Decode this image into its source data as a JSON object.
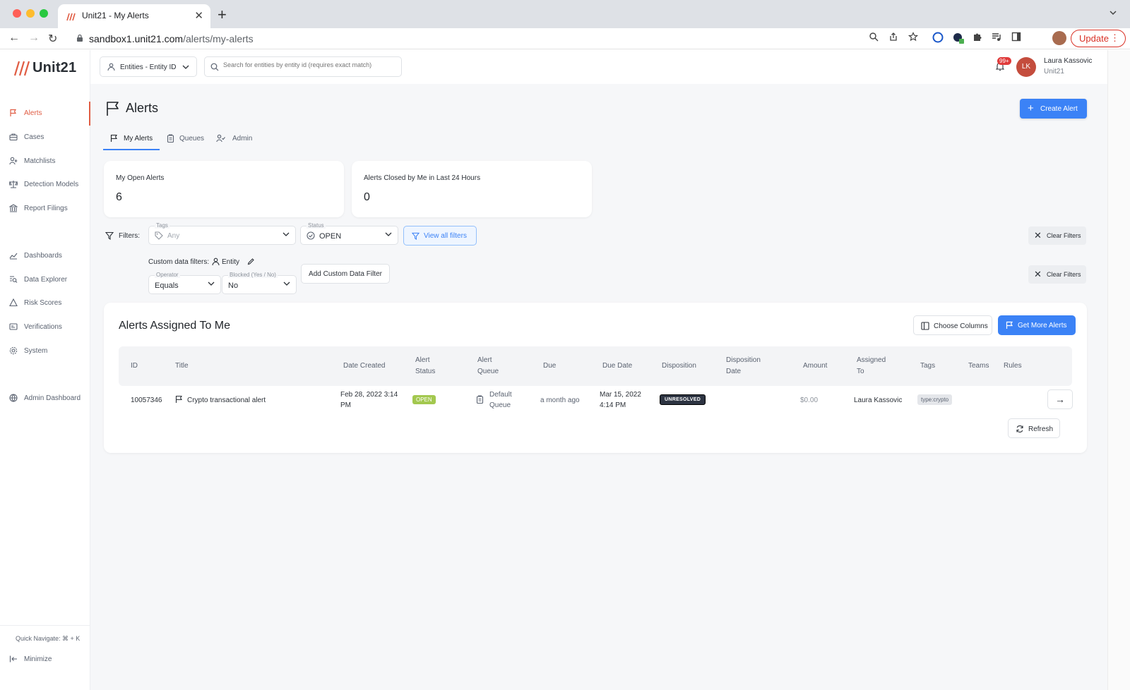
{
  "browser": {
    "tab_title": "Unit21 - My Alerts",
    "url_host": "sandbox1.unit21.com",
    "url_path": "/alerts/my-alerts",
    "update_label": "Update"
  },
  "sidebar": {
    "brand": "Unit21",
    "items": [
      {
        "label": "Alerts",
        "icon": "flag-icon"
      },
      {
        "label": "Cases",
        "icon": "briefcase-icon"
      },
      {
        "label": "Matchlists",
        "icon": "user-plus-icon"
      },
      {
        "label": "Detection Models",
        "icon": "scale-icon"
      },
      {
        "label": "Report Filings",
        "icon": "bank-icon"
      },
      {
        "label": "Dashboards",
        "icon": "chart-icon"
      },
      {
        "label": "Data Explorer",
        "icon": "search-list-icon"
      },
      {
        "label": "Risk Scores",
        "icon": "warning-icon"
      },
      {
        "label": "Verifications",
        "icon": "id-card-icon"
      },
      {
        "label": "System",
        "icon": "gear-icon"
      },
      {
        "label": "Admin Dashboard",
        "icon": "globe-icon"
      }
    ],
    "quick_navigate": "Quick Navigate: ⌘ + K",
    "minimize": "Minimize"
  },
  "topbar": {
    "entity_select": "Entities - Entity ID",
    "search_placeholder": "Search for entities by entity id (requires exact match)",
    "notification_badge": "99+",
    "user_initials": "LK",
    "user_name": "Laura Kassovic",
    "user_org": "Unit21"
  },
  "page": {
    "title": "Alerts",
    "create_button": "Create Alert",
    "tabs": [
      {
        "label": "My Alerts",
        "active": true
      },
      {
        "label": "Queues",
        "active": false
      },
      {
        "label": "Admin",
        "active": false
      }
    ],
    "stats": [
      {
        "label": "My Open Alerts",
        "value": "6"
      },
      {
        "label": "Alerts Closed by Me in Last 24 Hours",
        "value": "0"
      }
    ]
  },
  "filters": {
    "label": "Filters:",
    "tags": {
      "label": "Tags",
      "value": "Any"
    },
    "status": {
      "label": "Status",
      "value": "OPEN"
    },
    "view_all": "View all filters",
    "clear": "Clear Filters",
    "custom_label": "Custom data filters:",
    "custom_entity": "Entity",
    "operator": {
      "label": "Operator",
      "value": "Equals"
    },
    "blocked": {
      "label": "Blocked (Yes / No)",
      "value": "No"
    },
    "add_custom": "Add Custom Data Filter"
  },
  "table": {
    "title": "Alerts Assigned To Me",
    "choose_columns": "Choose Columns",
    "get_more": "Get More Alerts",
    "refresh": "Refresh",
    "headers": {
      "id": "ID",
      "title": "Title",
      "date_created": "Date Created",
      "alert_status_1": "Alert",
      "alert_status_2": "Status",
      "alert_queue_1": "Alert",
      "alert_queue_2": "Queue",
      "due": "Due",
      "due_date": "Due Date",
      "disposition": "Disposition",
      "disposition_date_1": "Disposition",
      "disposition_date_2": "Date",
      "amount": "Amount",
      "assigned_to_1": "Assigned",
      "assigned_to_2": "To",
      "tags": "Tags",
      "teams": "Teams",
      "rules": "Rules"
    },
    "row": {
      "id": "10057346",
      "title": "Crypto transactional alert",
      "date_created_1": "Feb 28, 2022 3:14",
      "date_created_2": "PM",
      "status": "OPEN",
      "queue_1": "Default",
      "queue_2": "Queue",
      "due": "a month ago",
      "due_date_1": "Mar 15, 2022",
      "due_date_2": "4:14 PM",
      "disposition": "UNRESOLVED",
      "amount": "$0.00",
      "assigned_to": "Laura Kassovic",
      "tag": "type:crypto"
    }
  },
  "colors": {
    "accent": "#3b82f6",
    "brand": "#e05d44",
    "open_status": "#a3c84f",
    "unresolved": "#2d3442"
  }
}
